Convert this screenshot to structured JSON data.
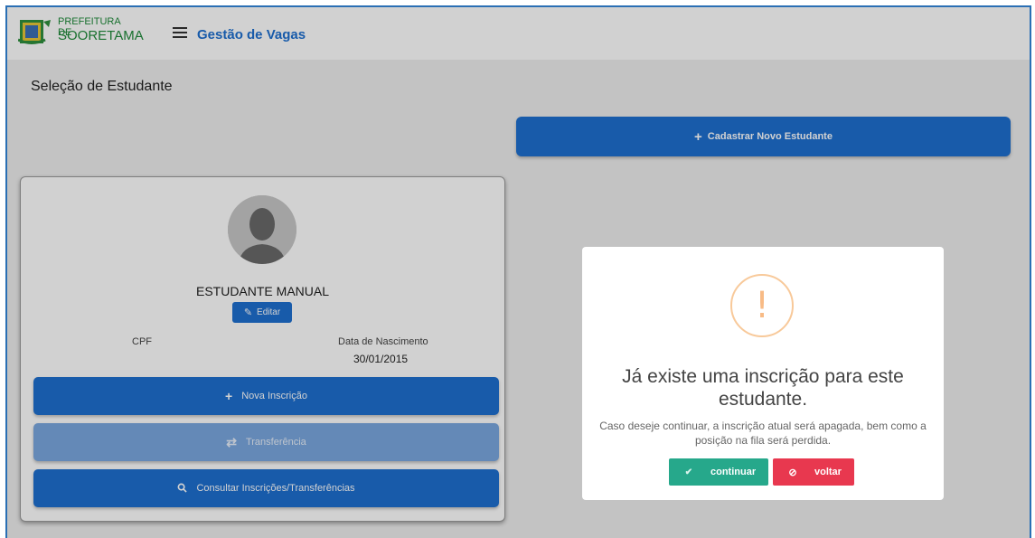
{
  "header": {
    "logo_line1": "PREFEITURA DE",
    "logo_line2": "SOORETAMA",
    "app_title": "Gestão de Vagas",
    "menu_icon": "hamburger-icon"
  },
  "page": {
    "title": "Seleção de Estudante"
  },
  "actions": {
    "new_student_label": "Cadastrar Novo Estudante",
    "new_student_icon": "plus-icon"
  },
  "student": {
    "name": "ESTUDANTE MANUAL",
    "edit_label": "Editar",
    "cpf_label": "CPF",
    "cpf_value": "",
    "birth_label": "Data de Nascimento",
    "birth_value": "30/01/2015",
    "buttons": {
      "nova_inscricao": "Nova Inscrição",
      "transferencia": "Transferência",
      "consultar": "Consultar Inscrições/Transferências"
    }
  },
  "modal": {
    "icon": "warning-icon",
    "title": "Já existe uma inscrição para este estudante.",
    "text": "Caso deseje continuar, a inscrição atual será apagada, bem como a posição na fila será perdida.",
    "continue_label": "continuar",
    "back_label": "voltar"
  },
  "colors": {
    "primary": "#1e6fd0",
    "primary_disabled": "#7aa8e0",
    "success": "#26a88b",
    "danger": "#e8384f",
    "warning": "#f8bb86",
    "brand_green": "#1f8a3a"
  }
}
